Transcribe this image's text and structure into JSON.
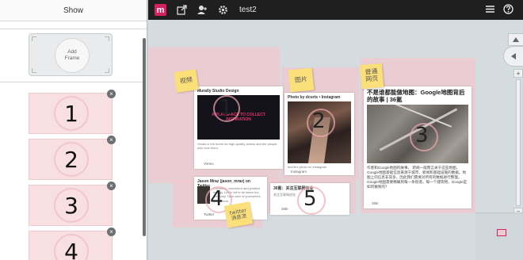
{
  "left_panel": {
    "header": "Show",
    "add_frame": {
      "line1": "Add",
      "line2": "Frame"
    },
    "frames": [
      {
        "number": "1",
        "close": "×"
      },
      {
        "number": "2",
        "close": "×"
      },
      {
        "number": "3",
        "close": "×"
      },
      {
        "number": "4",
        "close": "×"
      }
    ]
  },
  "topbar": {
    "logo": "m",
    "doc_title": "test2"
  },
  "canvas": {
    "stickies": {
      "video": "视频",
      "images": "图片",
      "web": "普通\n网页",
      "twitter": "twitter\n消息流"
    },
    "card1": {
      "title": "Murally Studio Design",
      "banner": "A PLAYSPACE TO COLLECT INSPIRATION",
      "desc": "Vimeo is the home for high-quality videos and the people who love them.",
      "source": "Vimeo",
      "number": "1"
    },
    "card2": {
      "title": "Photo by dcurts • Instagram",
      "desc": "dcurts's photo on Instagram",
      "source": "Instagram",
      "number": "2"
    },
    "card3": {
      "title": "不是谁都能做地图：Google地图背后的故事 | 36氪",
      "body": "作者和Google地图的故事。 新闻一般而言关于这些地图，Google地图基础信息来源于城市、新闻和基础设施的数据。地图上的信息非常多，因此我们需要对所有的数据进行整理。Google地图需要精确到每一条街道，每一个建筑物，Google是如何做到的？",
      "source": "36kr",
      "number": "3"
    },
    "card4": {
      "title": "Jason Mraz (jason_mraz) on Twitter",
      "desc": "Creativity, nonviolent and positive energy. Life's not to be taken too seriously. Take care of yourselves and others.",
      "source": "Twitter",
      "number": "4"
    },
    "card5": {
      "title": "36氪：关注互联网创业",
      "subtitle": "关注互联网创业",
      "source": "36kr",
      "number": "5"
    }
  },
  "colors": {
    "accent": "#d6205f",
    "topbar": "#1f1f1f",
    "zone": "#f0c8cd",
    "sticky": "#fbe07a"
  }
}
